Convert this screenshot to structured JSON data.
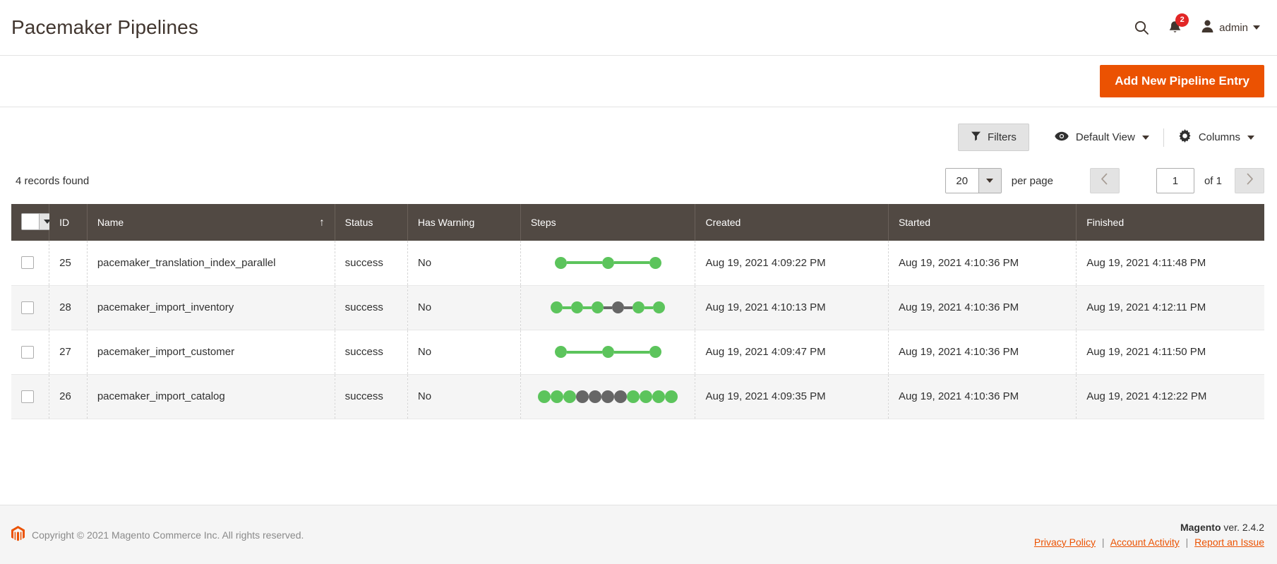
{
  "header": {
    "title": "Pacemaker Pipelines",
    "search_icon": "search-icon",
    "notifications_icon": "bell-icon",
    "notifications_count": "2",
    "admin_label": "admin",
    "admin_icon": "user-icon"
  },
  "action_bar": {
    "add_button_label": "Add New Pipeline Entry"
  },
  "toolbar": {
    "filters_label": "Filters",
    "filters_icon": "funnel-icon",
    "view_label": "Default View",
    "view_icon": "eye-icon",
    "columns_label": "Columns",
    "columns_icon": "gear-icon"
  },
  "pager": {
    "records_found": "4 records found",
    "per_page_value": "20",
    "per_page_label": "per page",
    "current_page": "1",
    "of_label": "of 1",
    "prev_icon": "chevron-left-icon",
    "next_icon": "chevron-right-icon"
  },
  "grid": {
    "columns": [
      {
        "key": "check",
        "label": ""
      },
      {
        "key": "id",
        "label": "ID"
      },
      {
        "key": "name",
        "label": "Name",
        "sort": "↑"
      },
      {
        "key": "status",
        "label": "Status"
      },
      {
        "key": "warning",
        "label": "Has Warning"
      },
      {
        "key": "steps",
        "label": "Steps"
      },
      {
        "key": "created",
        "label": "Created"
      },
      {
        "key": "started",
        "label": "Started"
      },
      {
        "key": "finished",
        "label": "Finished"
      }
    ],
    "rows": [
      {
        "id": "25",
        "name": "pacemaker_translation_index_parallel",
        "status": "success",
        "warning": "No",
        "created": "Aug 19, 2021 4:09:22 PM",
        "started": "Aug 19, 2021 4:10:36 PM",
        "finished": "Aug 19, 2021 4:11:48 PM",
        "steps": {
          "style": "spaced",
          "node_size": 17,
          "link_length": 50,
          "nodes": [
            "green",
            "green",
            "green"
          ]
        }
      },
      {
        "id": "28",
        "name": "pacemaker_import_inventory",
        "status": "success",
        "warning": "No",
        "created": "Aug 19, 2021 4:10:13 PM",
        "started": "Aug 19, 2021 4:10:36 PM",
        "finished": "Aug 19, 2021 4:12:11 PM",
        "steps": {
          "style": "spaced",
          "node_size": 17,
          "link_length": 12,
          "nodes": [
            "green",
            "green",
            "green",
            "gray",
            "green",
            "green"
          ]
        }
      },
      {
        "id": "27",
        "name": "pacemaker_import_customer",
        "status": "success",
        "warning": "No",
        "created": "Aug 19, 2021 4:09:47 PM",
        "started": "Aug 19, 2021 4:10:36 PM",
        "finished": "Aug 19, 2021 4:11:50 PM",
        "steps": {
          "style": "spaced",
          "node_size": 17,
          "link_length": 50,
          "nodes": [
            "green",
            "green",
            "green"
          ]
        }
      },
      {
        "id": "26",
        "name": "pacemaker_import_catalog",
        "status": "success",
        "warning": "No",
        "created": "Aug 19, 2021 4:09:35 PM",
        "started": "Aug 19, 2021 4:10:36 PM",
        "finished": "Aug 19, 2021 4:12:22 PM",
        "steps": {
          "style": "packed",
          "node_size": 18,
          "link_length": 0,
          "nodes": [
            "green",
            "green",
            "green",
            "gray",
            "gray",
            "gray",
            "gray",
            "green",
            "green",
            "green",
            "green"
          ]
        }
      }
    ]
  },
  "footer": {
    "logo_icon": "magento-logo-icon",
    "copyright": "Copyright © 2021 Magento Commerce Inc. All rights reserved.",
    "brand": "Magento",
    "version": " ver. 2.4.2",
    "links": [
      {
        "label": "Privacy Policy"
      },
      {
        "label": "Account Activity"
      },
      {
        "label": "Report an Issue"
      }
    ]
  },
  "colors": {
    "accent_orange": "#eb5202",
    "header_brown": "#514943",
    "step_green": "#5cc45c",
    "step_gray": "#666666",
    "badge_red": "#e22626"
  }
}
